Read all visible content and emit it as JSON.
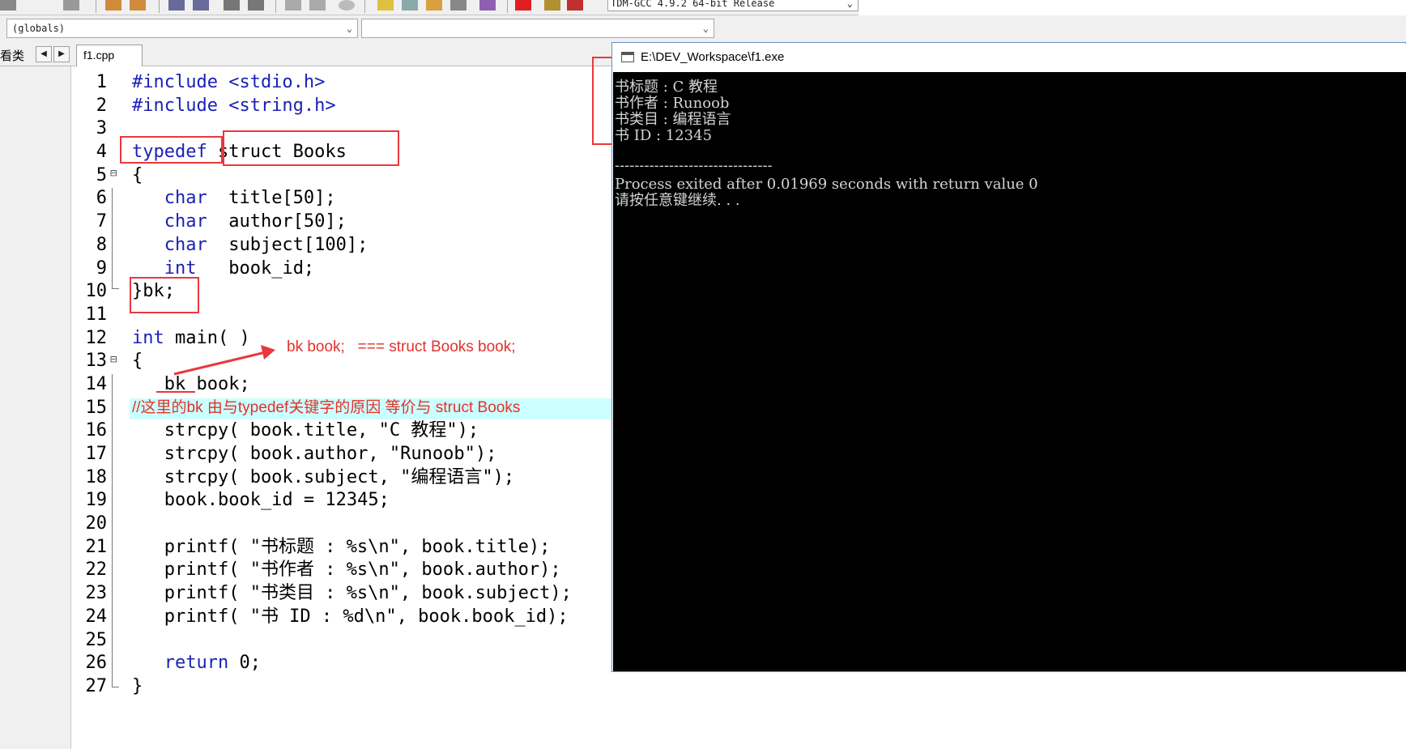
{
  "toolbar": {
    "compiler": "TDM-GCC 4.9.2 64-bit Release"
  },
  "combos": {
    "scope": "(globals)",
    "second": ""
  },
  "left_panel": {
    "label": "看类"
  },
  "tab": {
    "file": "f1.cpp"
  },
  "editor": {
    "line_numbers": [
      "1",
      "2",
      "3",
      "4",
      "5",
      "6",
      "7",
      "8",
      "9",
      "10",
      "11",
      "12",
      "13",
      "14",
      "15",
      "16",
      "17",
      "18",
      "19",
      "20",
      "21",
      "22",
      "23",
      "24",
      "25",
      "26",
      "27"
    ],
    "lines": {
      "l1": "#include <stdio.h>",
      "l2": "#include <string.h>",
      "l4a": "typedef",
      "l4b": " struct Books",
      "l5": "{",
      "l6a": "   char",
      "l6b": "  title[50];",
      "l7a": "   char",
      "l7b": "  author[50];",
      "l8a": "   char",
      "l8b": "  subject[100];",
      "l9a": "   int",
      "l9b": "   book_id;",
      "l10": "}bk;",
      "l12a": "int",
      "l12b": " main( )",
      "l13": "{",
      "l14": "   bk book;",
      "l15": "//这里的bk 由与typedef关键字的原因 等价与 struct Books",
      "l16": "   strcpy( book.title, \"C 教程\");",
      "l17": "   strcpy( book.author, \"Runoob\");",
      "l18": "   strcpy( book.subject, \"编程语言\");",
      "l19": "   book.book_id = 12345;",
      "l21": "   printf( \"书标题 : %s\\n\", book.title);",
      "l22": "   printf( \"书作者 : %s\\n\", book.author);",
      "l23": "   printf( \"书类目 : %s\\n\", book.subject);",
      "l24": "   printf( \"书 ID : %d\\n\", book.book_id);",
      "l26a": "   return",
      "l26b": " 0;",
      "l27": "}"
    }
  },
  "annotation": {
    "bk_equivalence": "bk book;   === struct Books book;"
  },
  "console": {
    "title": "E:\\DEV_Workspace\\f1.exe",
    "lines": [
      "书标题 : C 教程",
      "书作者 : Runoob",
      "书类目 : 编程语言",
      "书 ID : 12345",
      "",
      "--------------------------------",
      "Process exited after 0.01969 seconds with return value 0",
      "请按任意键继续. . ."
    ]
  },
  "colors": {
    "keyword": "#1a22b5",
    "annotation_red": "#e8383d",
    "highlight_line": "#ccffff",
    "console_bg": "#000000"
  }
}
